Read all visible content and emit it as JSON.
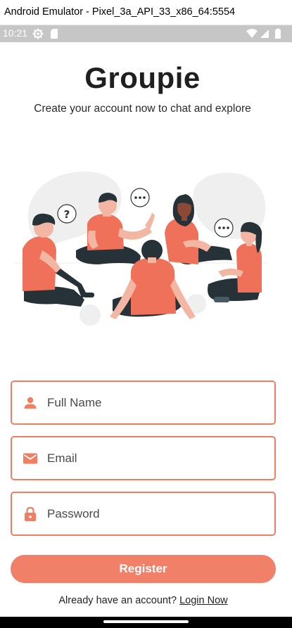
{
  "window": {
    "title": "Android Emulator - Pixel_3a_API_33_x86_64:5554"
  },
  "status_bar": {
    "time": "10:21",
    "left_icons": [
      "settings-gear-icon",
      "sd-card-icon"
    ],
    "right_icons": [
      "wifi-icon",
      "cell-signal-icon",
      "battery-icon"
    ]
  },
  "app": {
    "title": "Groupie",
    "subtitle": "Create your account now to chat and explore"
  },
  "form": {
    "full_name": {
      "placeholder": "Full Name",
      "value": "",
      "icon": "person-icon"
    },
    "email": {
      "placeholder": "Email",
      "value": "",
      "icon": "mail-icon"
    },
    "password": {
      "placeholder": "Password",
      "value": "",
      "icon": "lock-icon"
    },
    "register_label": "Register",
    "login_prompt": "Already have an account?",
    "login_link": "Login Now"
  },
  "colors": {
    "accent": "#f08168",
    "field_border": "#ef7f63",
    "status_bar": "#c6c6c6",
    "shirt": "#f0715a",
    "pants": "#263238"
  }
}
